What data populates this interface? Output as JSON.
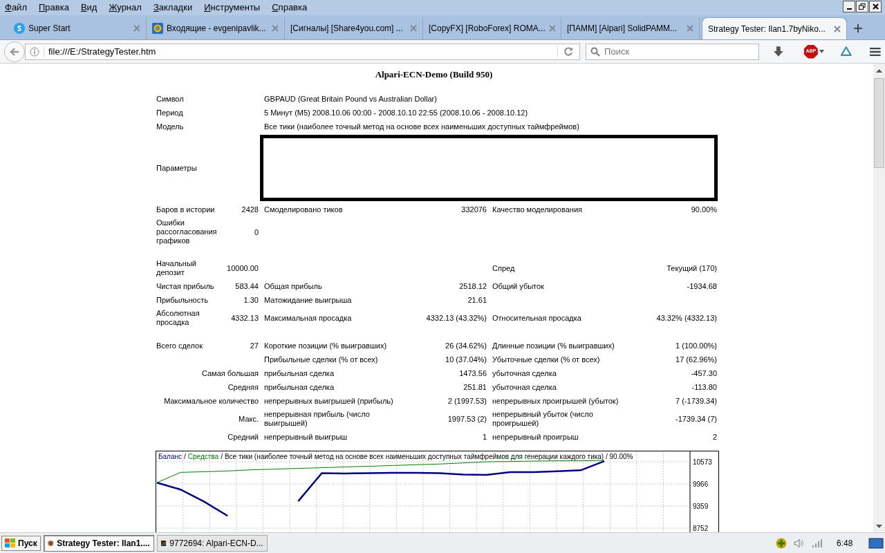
{
  "menu": [
    "Файл",
    "Правка",
    "Вид",
    "Журнал",
    "Закладки",
    "Инструменты",
    "Справка"
  ],
  "tabs": [
    {
      "title": "Super Start",
      "selected": false
    },
    {
      "title": "Входящие - evgenipavlik...",
      "selected": false
    },
    {
      "title": "[Сигналы] [Share4you.com] ...",
      "selected": false
    },
    {
      "title": "[CopyFX] [RoboForex] ROMA...",
      "selected": false
    },
    {
      "title": "[ПАММ] [Alpari] SolidPAMM...",
      "selected": false
    },
    {
      "title": "Strategy Tester: Ilan1.7byNiko...",
      "selected": true
    }
  ],
  "nav": {
    "url": "file:///E:/StrategyTester.htm",
    "search_placeholder": "Поиск",
    "adblock_label": "ABP"
  },
  "report": {
    "header": "Alpari-ECN-Demo (Build 950)",
    "sections": [
      [
        {
          "kind": "info",
          "label": "Символ",
          "value": "GBPAUD (Great Britain Pound vs Australian Dollar)"
        },
        {
          "kind": "info",
          "label": "Период",
          "value": "5 Минут (M5) 2008.10.06 00:00 - 2008.10.10 22:55 (2008.10.06 - 2008.10.12)"
        },
        {
          "kind": "info",
          "label": "Модель",
          "value": "Все тики (наиболее точный метод на основе всех наименьших доступных таймфреймов)"
        },
        {
          "kind": "params",
          "label": "Параметры"
        },
        {
          "kind": "stats",
          "cells": [
            "Баров в истории",
            "2428",
            "Смоделировано тиков",
            "332076",
            "Качество моделирования",
            "90.00%"
          ]
        },
        {
          "kind": "stats",
          "cells": [
            "Ошибки рассогласования графиков",
            "0",
            null,
            null,
            null,
            null
          ]
        }
      ],
      [
        {
          "kind": "stats",
          "cells": [
            "Начальный депозит",
            "10000.00",
            null,
            null,
            "Спред",
            "Текущий (170)"
          ]
        },
        {
          "kind": "stats",
          "cells": [
            "Чистая прибыль",
            "583.44",
            "Общая прибыль",
            "2518.12",
            "Общий убыток",
            "-1934.68"
          ]
        },
        {
          "kind": "stats",
          "cells": [
            "Прибыльность",
            "1.30",
            "Матожидание выигрыша",
            "21.61",
            null,
            null
          ]
        },
        {
          "kind": "stats",
          "cells": [
            "Абсолютная просадка",
            "4332.13",
            "Максимальная просадка",
            "4332.13 (43.32%)",
            "Относительная просадка",
            "43.32% (4332.13)"
          ]
        }
      ],
      [
        {
          "kind": "stats",
          "cells": [
            "Всего сделок",
            "27",
            "Короткие позиции (% выигравших)",
            "26 (34.62%)",
            "Длинные позиции (% выигравших)",
            "1 (100.00%)"
          ]
        },
        {
          "kind": "stats",
          "cells": [
            null,
            null,
            "Прибыльные сделки (% от всех)",
            "10 (37.04%)",
            "Убыточные сделки (% от всех)",
            "17 (62.96%)"
          ]
        },
        {
          "kind": "summary",
          "heading": "Самая большая",
          "cells": [
            "прибыльная сделка",
            "1473.56",
            "убыточная сделка",
            "-457.30"
          ]
        },
        {
          "kind": "summary",
          "heading": "Средняя",
          "cells": [
            "прибыльная сделка",
            "251.81",
            "убыточная сделка",
            "-113.80"
          ]
        },
        {
          "kind": "summary",
          "heading": "Максимальное количество",
          "cells": [
            "непрерывных выигрышей (прибыль)",
            "2 (1997.53)",
            "непрерывных проигрышей (убыток)",
            "7 (-1739.34)"
          ]
        },
        {
          "kind": "summary",
          "heading": "Макс.",
          "cells": [
            "непрерывная прибыль (число выигрышей)",
            "1997.53 (2)",
            "непрерывный убыток (число проигрышей)",
            "-1739.34 (7)"
          ]
        },
        {
          "kind": "summary",
          "heading": "Средний",
          "cells": [
            "непрерывный выигрыш",
            "1",
            "непрерывный проигрыш",
            "2"
          ]
        }
      ]
    ],
    "chart_legend_separator": "/",
    "chart_data": {
      "type": "line",
      "title": "Все тики (наиболее точный метод на основе всех наименьших доступных таймфреймов для генерации каждого тика) / 90.00%",
      "grid": true,
      "series": [
        {
          "name": "Баланс",
          "color": "#000080",
          "values": [
            10000,
            9810,
            9480,
            9090,
            null,
            null,
            9490,
            10260,
            10250,
            10260,
            10270,
            10270,
            10260,
            10220,
            10210,
            10290,
            10290,
            10310,
            10340,
            10590
          ]
        },
        {
          "name": "Средства",
          "color": "#008000",
          "values": [
            10000,
            10280,
            10300,
            10320,
            10350,
            10370,
            10390,
            10410,
            10430,
            10450,
            10470,
            10490,
            10510,
            10540,
            10570,
            10580,
            10590,
            10600,
            10600,
            10610
          ]
        }
      ],
      "ylim": [
        8581,
        10857
      ],
      "yticks": [
        10573,
        9966,
        9359,
        8752
      ]
    }
  },
  "taskbar": {
    "start": "Пуск",
    "tasks": [
      {
        "title": "Strategy Tester: Ilan1....",
        "selected": true
      },
      {
        "title": "9772694: Alpari-ECN-D...",
        "selected": false
      }
    ],
    "clock": "6:48"
  }
}
